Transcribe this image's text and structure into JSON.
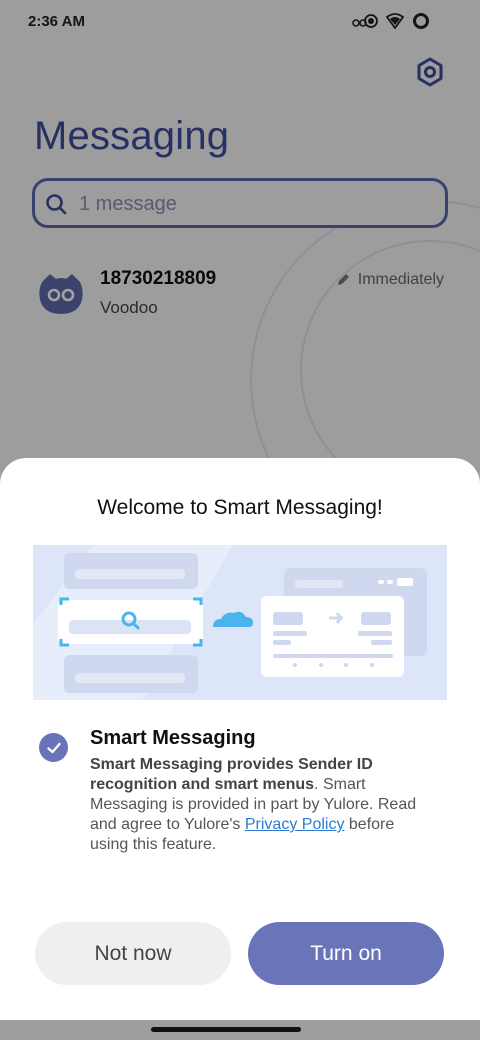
{
  "status_bar": {
    "time": "2:36 AM"
  },
  "app": {
    "title": "Messaging",
    "search": {
      "placeholder": "1 message"
    },
    "conversations": [
      {
        "sender": "18730218809",
        "snippet": "Voodoo",
        "time": "Immediately"
      }
    ]
  },
  "dialog": {
    "title": "Welcome to Smart Messaging!",
    "option": {
      "title": "Smart Messaging",
      "checked": true,
      "description_bold": "Smart Messaging provides Sender ID recognition and smart menus",
      "description_text": ". Smart Messaging is provided in part by Yulore. Read and agree to Yulore's ",
      "link_text": "Privacy Policy",
      "description_tail": " before using this feature."
    },
    "buttons": {
      "secondary": "Not now",
      "primary": "Turn on"
    }
  },
  "colors": {
    "accent": "#6a74b9",
    "title_blue": "#3e4c9a",
    "link": "#2a7bd4",
    "illustration_bg": "#dde6f9"
  },
  "icons": [
    "settings-icon",
    "search-icon",
    "bot-avatar-icon",
    "edit-icon",
    "check-icon"
  ]
}
